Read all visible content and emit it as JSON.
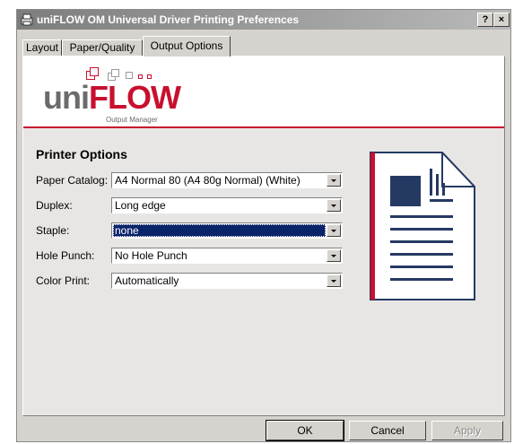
{
  "window": {
    "title": "uniFLOW OM Universal Driver Printing Preferences",
    "help_label": "?",
    "close_label": "×"
  },
  "tabs": [
    {
      "label": "Layout"
    },
    {
      "label": "Paper/Quality"
    },
    {
      "label": "Output Options",
      "active": true
    }
  ],
  "logo": {
    "brand_left": "uni",
    "brand_right": "FLOW",
    "subtitle": "Output Manager"
  },
  "printer_options": {
    "title": "Printer Options",
    "fields": [
      {
        "label": "Paper Catalog:",
        "value": "A4 Normal 80 (A4 80g Normal) (White)"
      },
      {
        "label": "Duplex:",
        "value": "Long edge"
      },
      {
        "label": "Staple:",
        "value": "none",
        "selected": true
      },
      {
        "label": "Hole Punch:",
        "value": "No Hole Punch"
      },
      {
        "label": "Color Print:",
        "value": "Automatically"
      }
    ]
  },
  "buttons": {
    "ok": "OK",
    "cancel": "Cancel",
    "apply": "Apply"
  },
  "colors": {
    "accent": "#c8102e",
    "doc_navy": "#253a63",
    "selection": "#0a246a"
  }
}
